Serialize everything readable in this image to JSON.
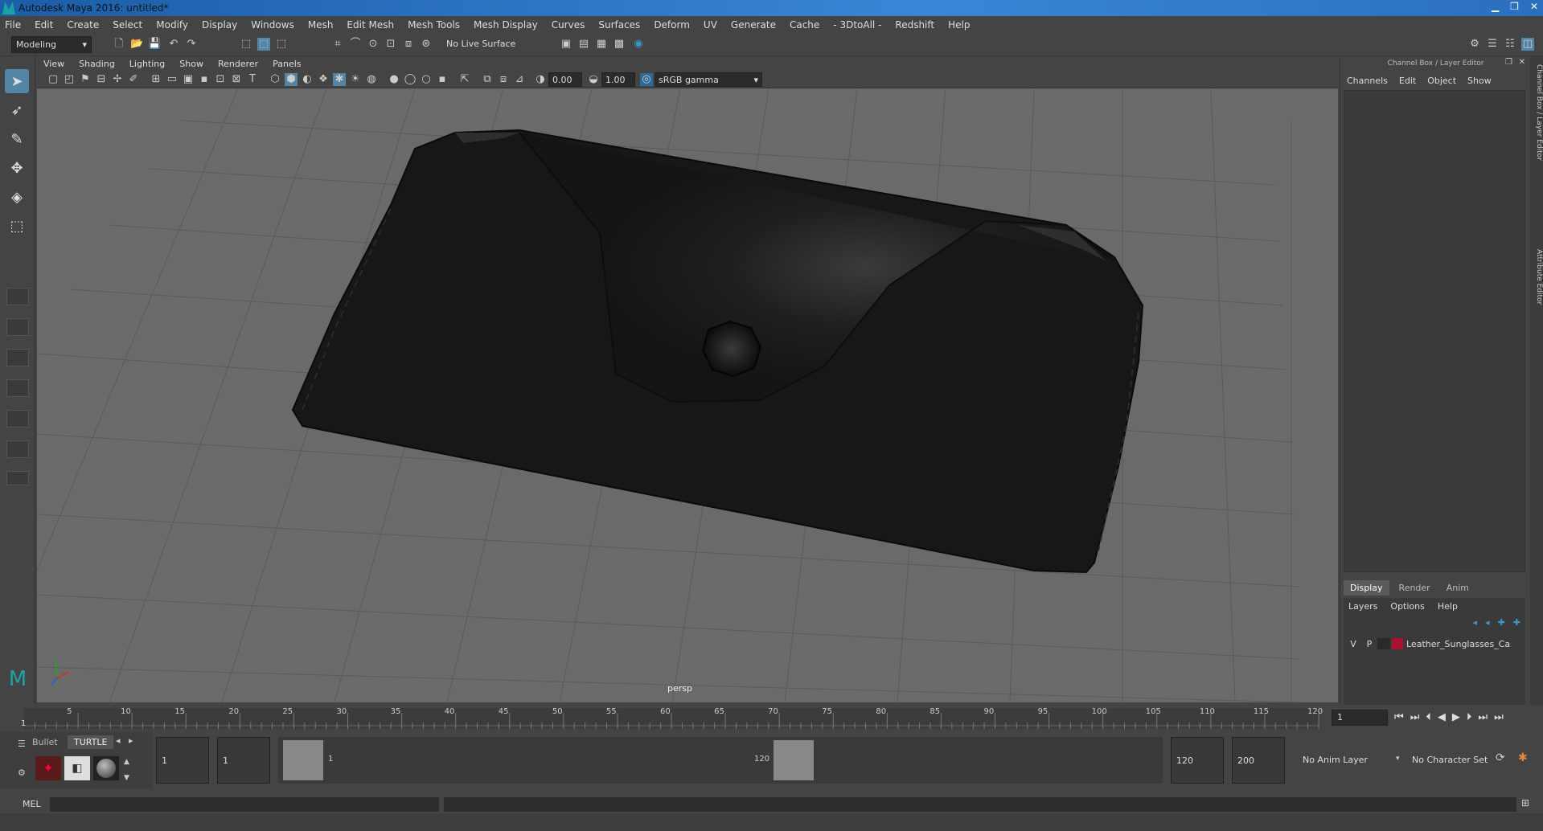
{
  "app": {
    "title": "Autodesk Maya 2016: untitled*"
  },
  "menus": [
    "File",
    "Edit",
    "Create",
    "Select",
    "Modify",
    "Display",
    "Windows",
    "Mesh",
    "Edit Mesh",
    "Mesh Tools",
    "Mesh Display",
    "Curves",
    "Surfaces",
    "Deform",
    "UV",
    "Generate",
    "Cache",
    "- 3DtoAll -",
    "Redshift",
    "Help"
  ],
  "shelf": {
    "mode": "Modeling",
    "live_surface": "No Live Surface"
  },
  "viewport": {
    "menus": [
      "View",
      "Shading",
      "Lighting",
      "Show",
      "Renderer",
      "Panels"
    ],
    "exposure": "0.00",
    "gamma": "1.00",
    "colorspace": "sRGB gamma",
    "camera_label": "persp"
  },
  "right_panel": {
    "header": "Channel Box / Layer Editor",
    "menus": [
      "Channels",
      "Edit",
      "Object",
      "Show"
    ],
    "tabs": [
      "Display",
      "Render",
      "Anim"
    ],
    "layer_menus": [
      "Layers",
      "Options",
      "Help"
    ],
    "layer": {
      "v": "V",
      "p": "P",
      "name": "Leather_Sunglasses_Case",
      "color": "#b01030"
    },
    "side_tabs": [
      "Channel Box / Layer Editor",
      "Attribute Editor"
    ]
  },
  "timeline": {
    "ticks": [
      "5",
      "10",
      "15",
      "20",
      "25",
      "30",
      "35",
      "40",
      "45",
      "50",
      "55",
      "60",
      "65",
      "70",
      "75",
      "80",
      "85",
      "90",
      "95",
      "100",
      "105",
      "110",
      "115",
      "120"
    ],
    "start_label": "1",
    "current_frame": "1"
  },
  "range": {
    "shelf_tabs": [
      "Bullet",
      "TURTLE"
    ],
    "start": "1",
    "inner_start": "1",
    "slider_start": "1",
    "slider_end": "120",
    "end": "120",
    "max_end": "200",
    "anim_layer": "No Anim Layer",
    "char_set": "No Character Set"
  },
  "cmd": {
    "label": "MEL"
  },
  "colors": {
    "bg": "#444444",
    "viewport": "#6a6a6a",
    "accent": "#5285a6"
  }
}
